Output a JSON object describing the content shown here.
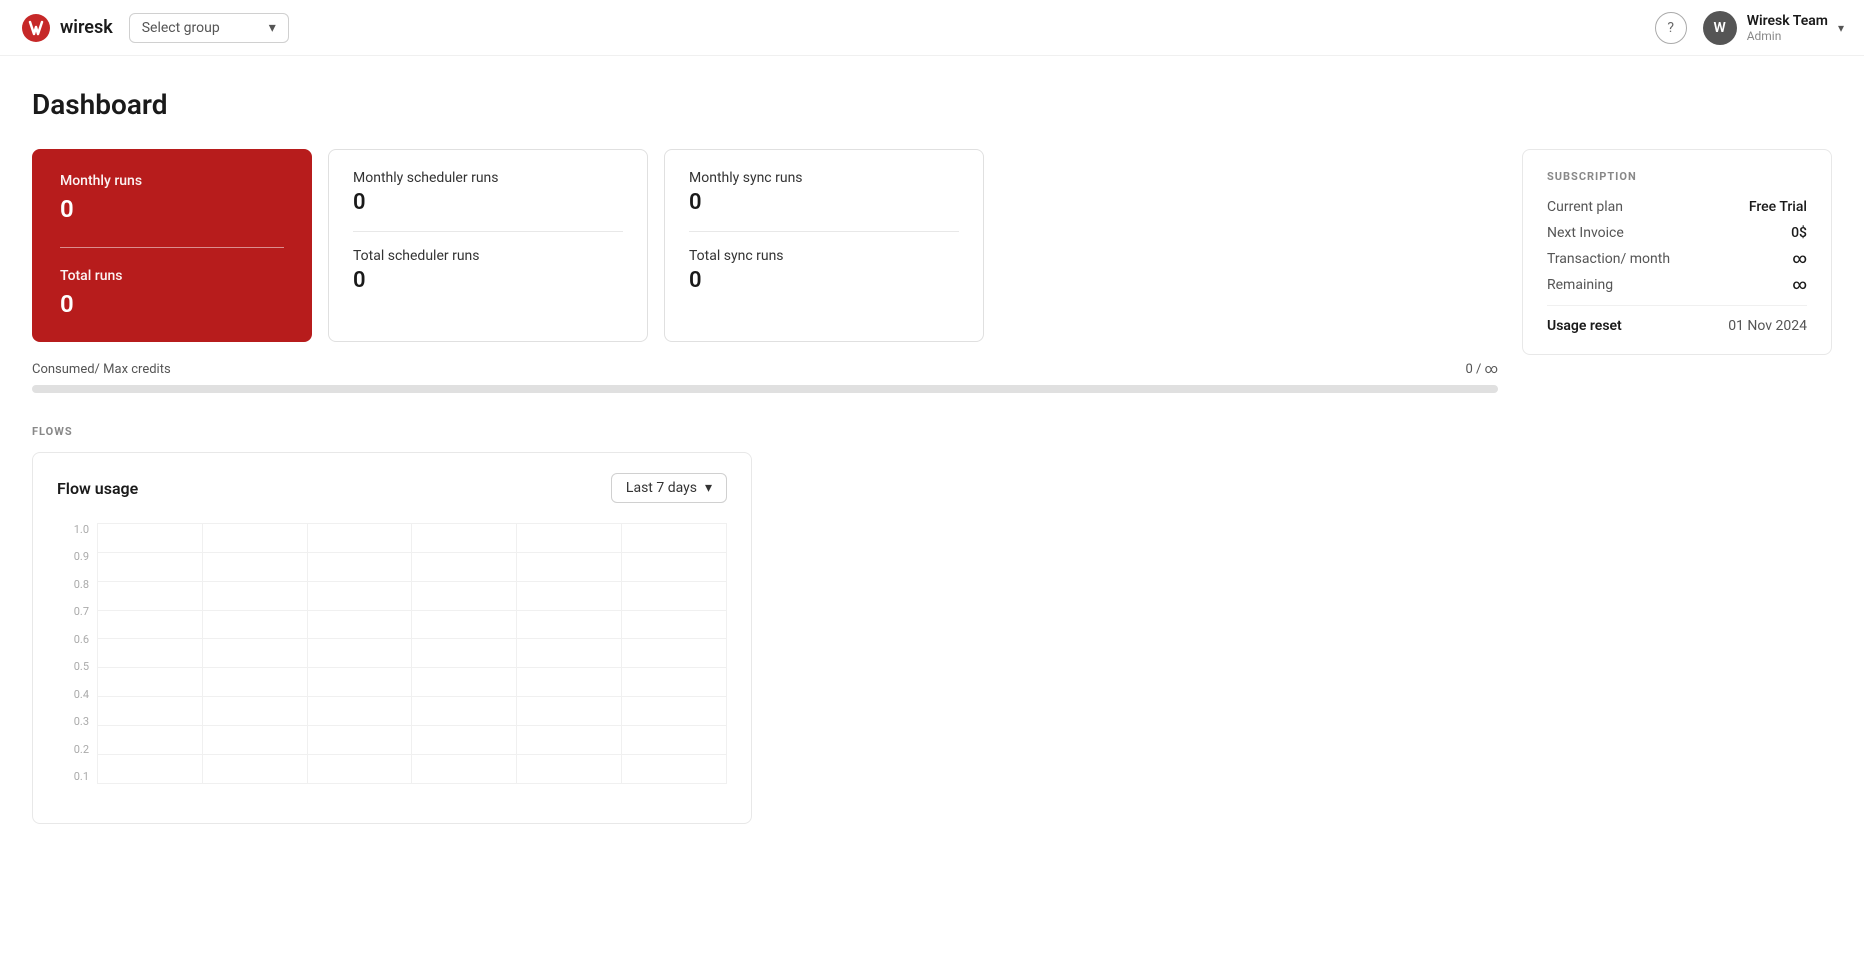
{
  "header": {
    "logo_text": "wiresk",
    "select_group_label": "Select group",
    "help_icon": "?",
    "user_name": "Wiresk Team",
    "user_role": "Admin",
    "user_initial": "W",
    "chevron": "▾"
  },
  "page": {
    "title": "Dashboard"
  },
  "monthly_runs_card": {
    "monthly_label": "Monthly runs",
    "monthly_value": "0",
    "total_label": "Total runs",
    "total_value": "0"
  },
  "scheduler_card": {
    "monthly_label": "Monthly scheduler runs",
    "monthly_value": "0",
    "total_label": "Total scheduler runs",
    "total_value": "0"
  },
  "sync_card": {
    "monthly_label": "Monthly sync runs",
    "monthly_value": "0",
    "total_label": "Total sync runs",
    "total_value": "0"
  },
  "credits": {
    "label": "Consumed/ Max credits",
    "value": "0 / ∞"
  },
  "subscription": {
    "section_title": "SUBSCRIPTION",
    "current_plan_label": "Current plan",
    "current_plan_value": "Free Trial",
    "next_invoice_label": "Next Invoice",
    "next_invoice_value": "0$",
    "transaction_label": "Transaction/ month",
    "transaction_value": "∞",
    "remaining_label": "Remaining",
    "remaining_value": "∞",
    "usage_reset_label": "Usage reset",
    "usage_reset_value": "01 Nov 2024"
  },
  "flows": {
    "section_title": "FLOWS",
    "card_title": "Flow usage",
    "period_label": "Last 7 days",
    "y_labels": [
      "1.0",
      "0.9",
      "0.8",
      "0.7",
      "0.6",
      "0.5",
      "0.4",
      "0.3",
      "0.2",
      "0.1"
    ],
    "grid_cols": 7,
    "grid_rows": 10
  }
}
